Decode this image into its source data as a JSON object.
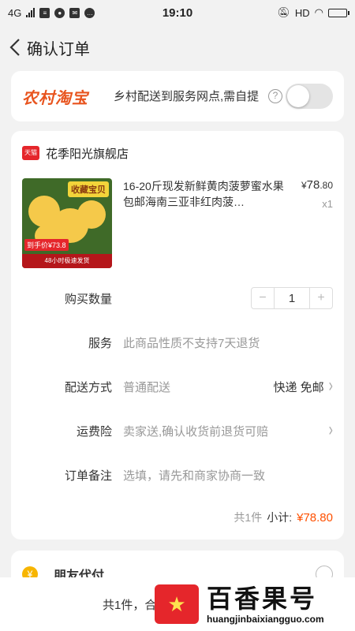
{
  "status_bar": {
    "network": "4G",
    "time": "19:10",
    "hd": "HD"
  },
  "nav": {
    "title": "确认订单"
  },
  "rural": {
    "logo_text": "农村淘宝",
    "description": "乡村配送到服务网点,需自提",
    "help_icon": "?"
  },
  "shop": {
    "badge": "天猫",
    "name": "花季阳光旗舰店"
  },
  "product": {
    "image_banner": "收藏宝贝",
    "image_price_tag": "到手价¥73.8",
    "image_strip": "48小时极速发货",
    "title": "16-20斤现发新鲜黄肉菠萝蜜水果包邮海南三亚非红肉菠…",
    "price_symbol": "¥",
    "price_int": "78",
    "price_dec": ".80",
    "qty": "x1"
  },
  "fields": {
    "quantity_label": "购买数量",
    "quantity_value": "1",
    "minus": "−",
    "plus": "+",
    "service_label": "服务",
    "service_value": "此商品性质不支持7天退货",
    "delivery_label": "配送方式",
    "delivery_value": "普通配送",
    "delivery_right": "快递 免邮",
    "insurance_label": "运费险",
    "insurance_value": "卖家送,确认收货前退货可赔",
    "note_label": "订单备注",
    "note_placeholder": "选填，请先和商家协商一致"
  },
  "summary": {
    "count": "共1件",
    "subtotal_label": "小计:",
    "subtotal_price": "¥78.80"
  },
  "friend_pay": {
    "label": "朋友代付",
    "icon": "¥"
  },
  "bottom_bar": {
    "count_text": "共1件，合"
  },
  "watermark": {
    "big": "百香果号",
    "small": "huangjinbaixiangguo.com"
  }
}
